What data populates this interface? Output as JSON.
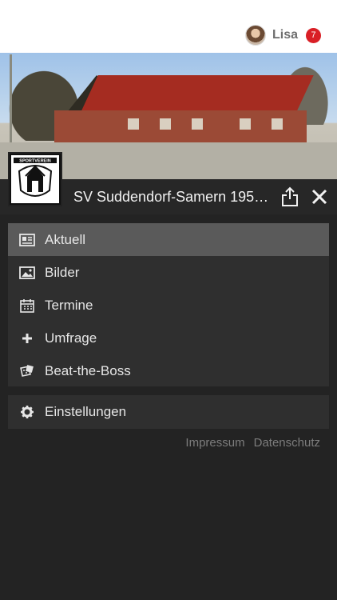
{
  "header": {
    "username": "Lisa",
    "notification_count": "7"
  },
  "club": {
    "name": "SV Suddendorf-Samern 1959...",
    "logo_text_top": "SPORTVEREIN",
    "logo_text_bottom": "SUDDENDORF-SAMERN"
  },
  "menu": {
    "items": [
      {
        "label": "Aktuell",
        "icon": "newspaper-icon",
        "active": true
      },
      {
        "label": "Bilder",
        "icon": "image-icon",
        "active": false
      },
      {
        "label": "Termine",
        "icon": "calendar-icon",
        "active": false
      },
      {
        "label": "Umfrage",
        "icon": "plus-icon",
        "active": false
      },
      {
        "label": "Beat-the-Boss",
        "icon": "dice-icon",
        "active": false
      }
    ]
  },
  "settings": {
    "label": "Einstellungen",
    "icon": "gear-icon"
  },
  "footer": {
    "impressum": "Impressum",
    "datenschutz": "Datenschutz"
  },
  "colors": {
    "background": "#232323",
    "panel": "#2f2f2f",
    "active_item": "#5a5a5a",
    "badge": "#d91f26"
  }
}
